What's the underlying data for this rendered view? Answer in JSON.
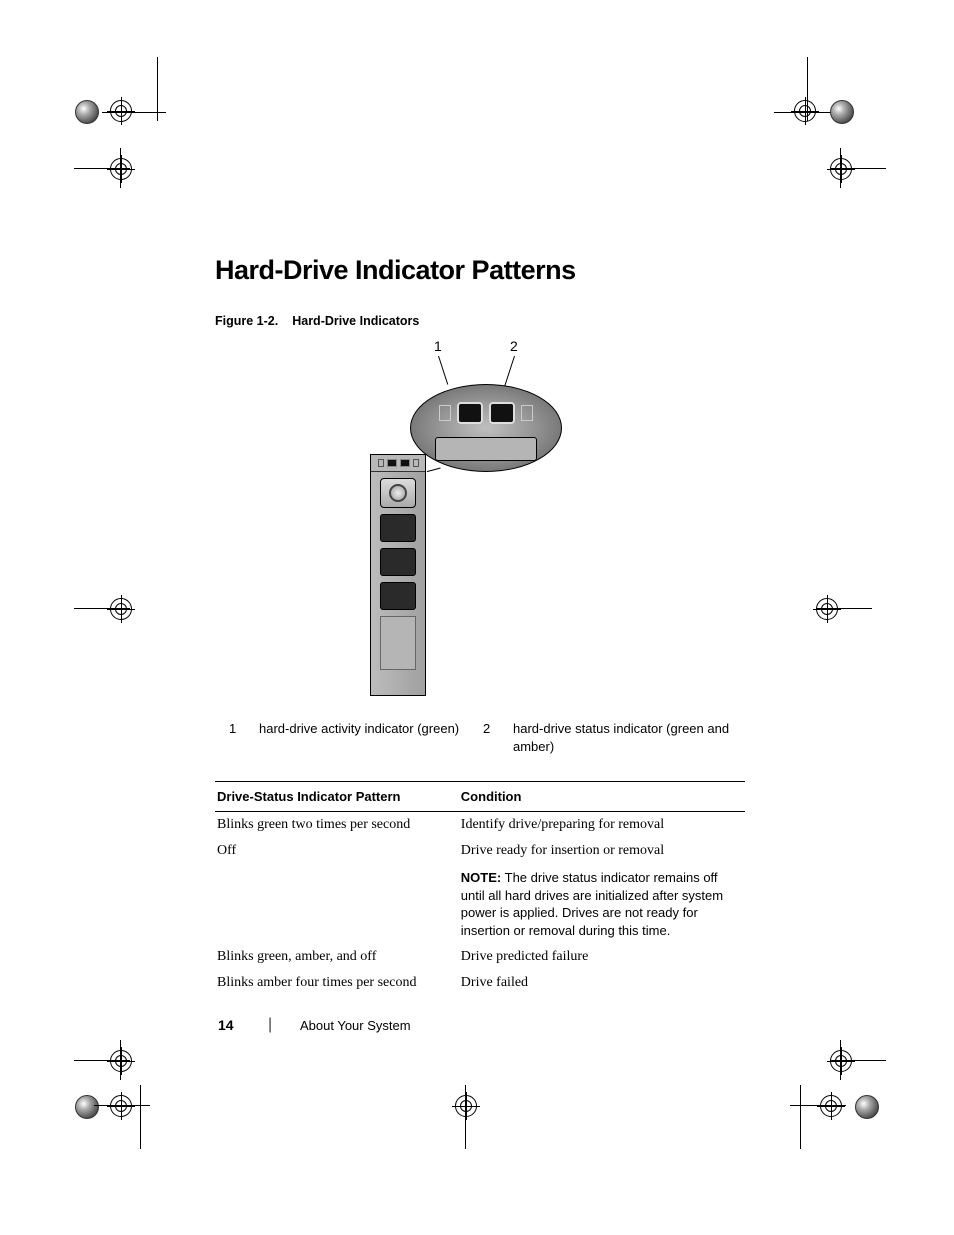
{
  "heading": "Hard-Drive Indicator Patterns",
  "figure": {
    "label": "Figure 1-2.",
    "title": "Hard-Drive Indicators",
    "callouts": {
      "c1": "1",
      "c2": "2"
    }
  },
  "legend": {
    "n1": "1",
    "t1": "hard-drive activity indicator (green)",
    "n2": "2",
    "t2": "hard-drive status indicator (green and amber)"
  },
  "table": {
    "headers": {
      "pattern": "Drive-Status Indicator Pattern",
      "condition": "Condition"
    },
    "rows": [
      {
        "pattern": "Blinks green two times per second",
        "condition": "Identify drive/preparing for removal"
      },
      {
        "pattern": "Off",
        "condition": "Drive ready for insertion or removal",
        "note_label": "NOTE:",
        "note_body": " The drive status indicator remains off until all hard drives are initialized after system power is applied. Drives are not ready for insertion or removal during this time."
      },
      {
        "pattern": "Blinks green, amber, and off",
        "condition": "Drive predicted failure"
      },
      {
        "pattern": "Blinks amber four times per second",
        "condition": "Drive failed"
      }
    ]
  },
  "footer": {
    "page_number": "14",
    "section": "About Your System"
  }
}
